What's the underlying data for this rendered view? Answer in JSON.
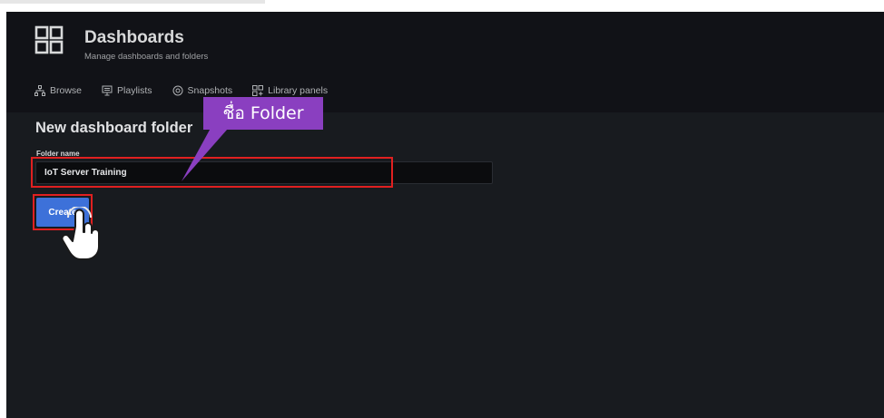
{
  "header": {
    "title": "Dashboards",
    "subtitle": "Manage dashboards and folders",
    "icon": "dashboard-grid-icon"
  },
  "tabs": [
    {
      "label": "Browse",
      "icon": "sitemap-icon"
    },
    {
      "label": "Playlists",
      "icon": "playlist-icon"
    },
    {
      "label": "Snapshots",
      "icon": "camera-icon"
    },
    {
      "label": "Library panels",
      "icon": "apps-icon"
    }
  ],
  "form": {
    "heading": "New dashboard folder",
    "folder_label": "Folder name",
    "folder_value": "IoT Server Training",
    "create_label": "Create"
  },
  "annotation": {
    "callout_text": "ชื่อ Folder",
    "callout_color": "#8a3fc0",
    "highlight_color": "#e02020",
    "pointer": "hand-pointer-icon"
  },
  "colors": {
    "background": "#181b1f",
    "header": "#111217",
    "primary_button": "#3d71d9"
  }
}
